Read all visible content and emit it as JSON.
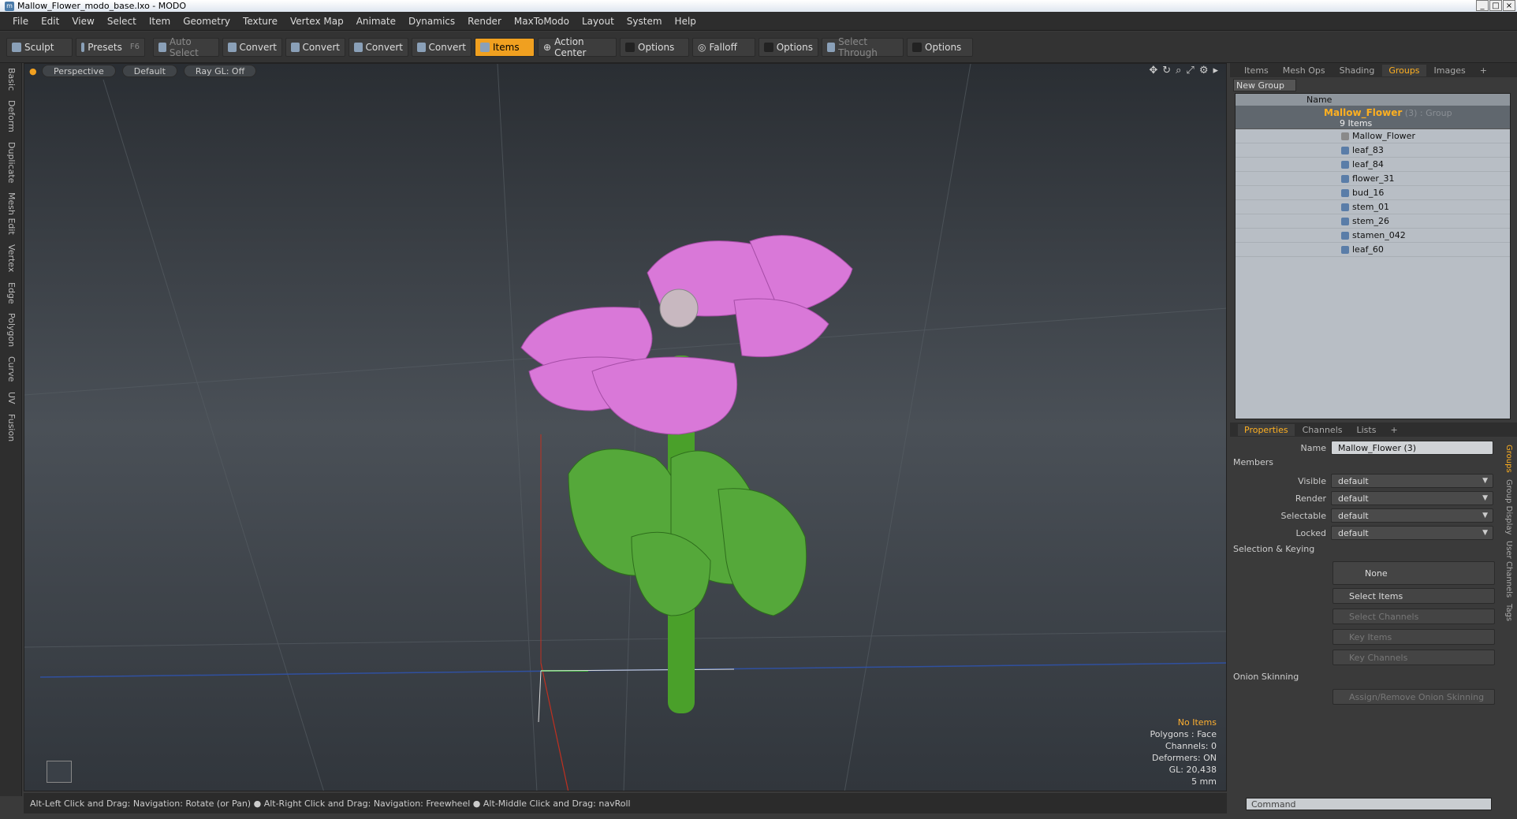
{
  "window": {
    "title": "Mallow_Flower_modo_base.lxo - MODO"
  },
  "menu": [
    "File",
    "Edit",
    "View",
    "Select",
    "Item",
    "Geometry",
    "Texture",
    "Vertex Map",
    "Animate",
    "Dynamics",
    "Render",
    "MaxToModo",
    "Layout",
    "System",
    "Help"
  ],
  "toolbar": {
    "sculpt": "Sculpt",
    "presets": "Presets",
    "presets_key": "F6",
    "auto_select": "Auto Select",
    "convert1": "Convert",
    "convert2": "Convert",
    "convert3": "Convert",
    "convert4": "Convert",
    "items": "Items",
    "action_center": "Action Center",
    "options1": "Options",
    "falloff": "Falloff",
    "options2": "Options",
    "select_through": "Select Through",
    "options3": "Options"
  },
  "left_tabs": [
    "Basic",
    "Deform",
    "Duplicate",
    "Mesh Edit",
    "Vertex",
    "Edge",
    "Polygon",
    "Curve",
    "UV",
    "Fusion"
  ],
  "viewport": {
    "view": "Perspective",
    "shading": "Default",
    "raygl": "Ray GL: Off",
    "hud": {
      "items": "No Items",
      "polygons": "Polygons : Face",
      "channels": "Channels: 0",
      "deformers": "Deformers: ON",
      "gl": "GL: 20,438",
      "scale": "5 mm"
    }
  },
  "status": "Alt-Left Click and Drag: Navigation: Rotate (or Pan) ● Alt-Right Click and Drag: Navigation: Freewheel ● Alt-Middle Click and Drag: navRoll",
  "right_tabs": [
    "Items",
    "Mesh Ops",
    "Shading",
    "Groups",
    "Images"
  ],
  "groups": {
    "new_group": "New Group",
    "col_name": "Name",
    "group_name": "Mallow_Flower",
    "group_suffix": "(3) : Group",
    "item_count": "9 Items",
    "items": [
      "Mallow_Flower",
      "leaf_83",
      "leaf_84",
      "flower_31",
      "bud_16",
      "stem_01",
      "stem_26",
      "stamen_042",
      "leaf_60"
    ]
  },
  "props_tabs": [
    "Properties",
    "Channels",
    "Lists"
  ],
  "properties": {
    "name_label": "Name",
    "name_value": "Mallow_Flower (3)",
    "members": "Members",
    "visible_label": "Visible",
    "visible": "default",
    "render_label": "Render",
    "render": "default",
    "selectable_label": "Selectable",
    "selectable": "default",
    "locked_label": "Locked",
    "locked": "default",
    "sel_keying": "Selection & Keying",
    "none": "None",
    "select_items": "Select Items",
    "select_channels": "Select Channels",
    "key_items": "Key Items",
    "key_channels": "Key Channels",
    "onion": "Onion Skinning",
    "assign_onion": "Assign/Remove Onion Skinning"
  },
  "side_vtabs": [
    "Groups",
    "Group Display",
    "User Channels",
    "Tags"
  ],
  "command_placeholder": "Command"
}
